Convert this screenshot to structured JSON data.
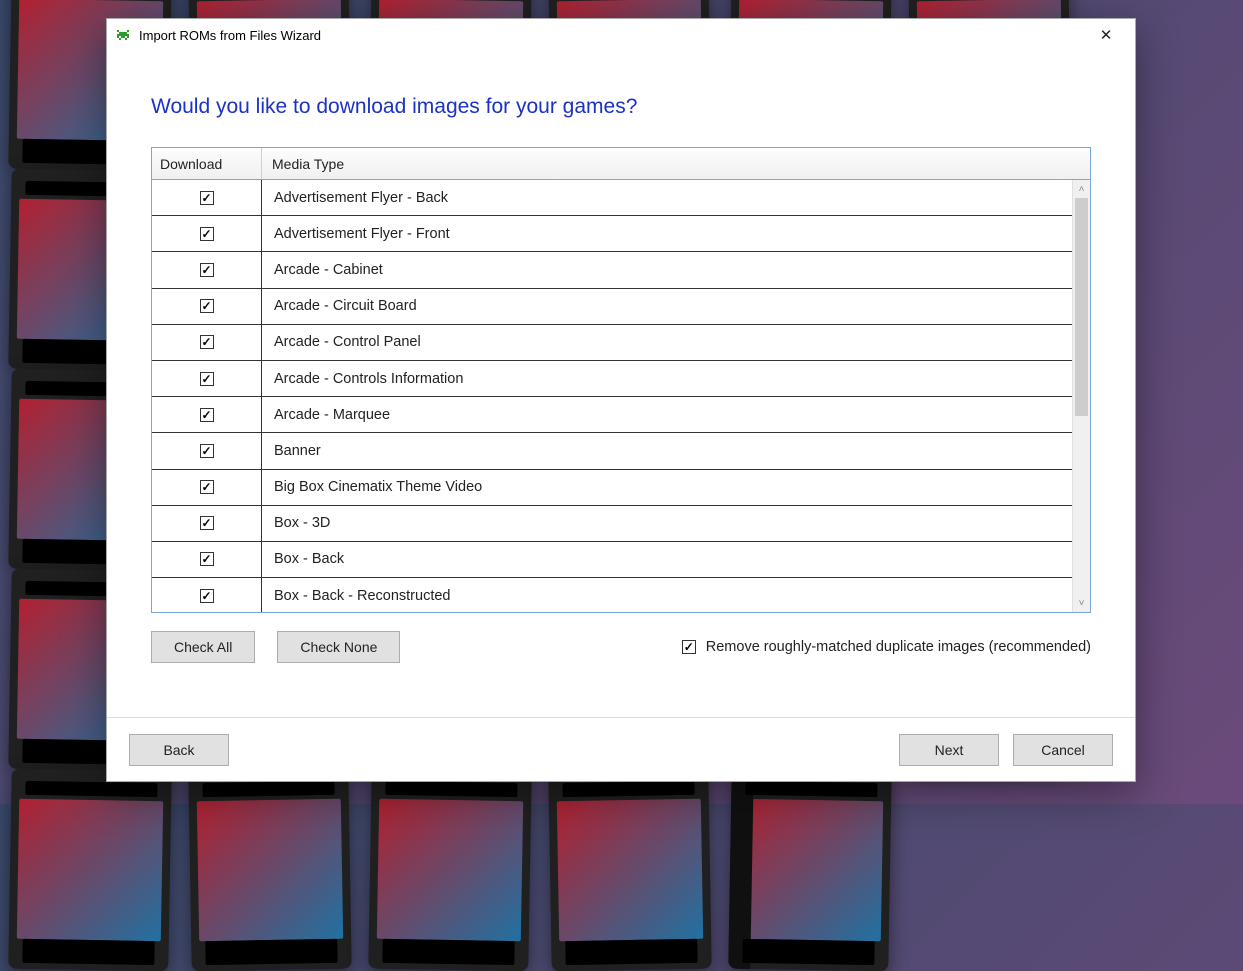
{
  "window": {
    "title": "Import ROMs from Files Wizard",
    "icon_name": "space-invader-icon"
  },
  "heading": "Would you like to download images for your games?",
  "columns": {
    "download": "Download",
    "media_type": "Media Type"
  },
  "rows": [
    {
      "checked": true,
      "label": "Advertisement Flyer - Back"
    },
    {
      "checked": true,
      "label": "Advertisement Flyer - Front"
    },
    {
      "checked": true,
      "label": "Arcade - Cabinet"
    },
    {
      "checked": true,
      "label": "Arcade - Circuit Board"
    },
    {
      "checked": true,
      "label": "Arcade - Control Panel"
    },
    {
      "checked": true,
      "label": "Arcade - Controls Information"
    },
    {
      "checked": true,
      "label": "Arcade - Marquee"
    },
    {
      "checked": true,
      "label": "Banner"
    },
    {
      "checked": true,
      "label": "Big Box Cinematix Theme Video"
    },
    {
      "checked": true,
      "label": "Box - 3D"
    },
    {
      "checked": true,
      "label": "Box - Back"
    },
    {
      "checked": true,
      "label": "Box - Back - Reconstructed"
    }
  ],
  "buttons": {
    "check_all": "Check All",
    "check_none": "Check None",
    "back": "Back",
    "next": "Next",
    "cancel": "Cancel"
  },
  "option": {
    "remove_dupes_checked": true,
    "remove_dupes_label": "Remove roughly-matched duplicate images (recommended)"
  },
  "scroll": {
    "up_glyph": "˄",
    "down_glyph": "˅"
  }
}
